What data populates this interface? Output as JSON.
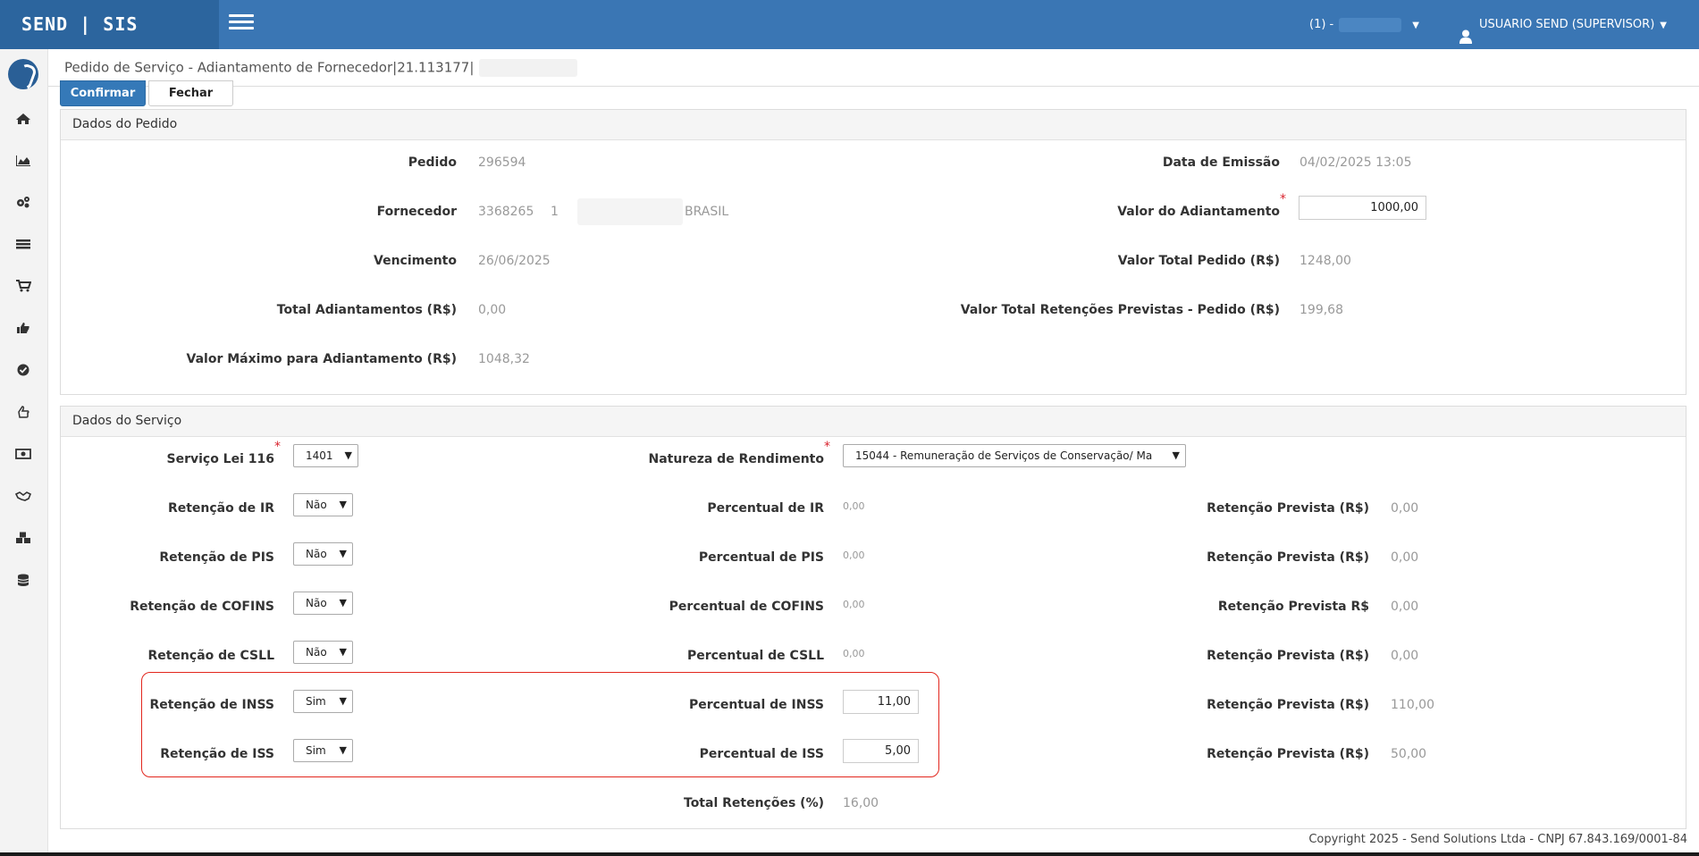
{
  "app": {
    "brand": "SEND | SIS",
    "env_label": "(1) -",
    "user": "USUARIO SEND (SUPERVISOR)"
  },
  "colors": {
    "header": "#3a76b4",
    "brand_bg": "#2c659e",
    "confirm": "#3579b8",
    "highlight": "#e2261d"
  },
  "page": {
    "breadcrumb": "Pedido de Serviço - Adiantamento de Fornecedor|21.113177|"
  },
  "toolbar": {
    "confirm": "Confirmar",
    "close": "Fechar"
  },
  "sidebar": {
    "icons": [
      "home-icon",
      "chart-icon",
      "cogs-icon",
      "list-icon",
      "cart-icon",
      "thumbs-up-icon",
      "check-circle-icon",
      "hand-icon",
      "money-icon",
      "handshake-icon",
      "cubes-icon",
      "database-icon"
    ]
  },
  "pedido": {
    "title": "Dados do Pedido",
    "pedido_label": "Pedido",
    "pedido_value": "296594",
    "fornecedor_label": "Fornecedor",
    "fornecedor_code": "3368265",
    "fornecedor_num": "1",
    "fornecedor_country": "BRASIL",
    "vencimento_label": "Vencimento",
    "vencimento_value": "26/06/2025",
    "total_adiant_label": "Total Adiantamentos (R$)",
    "total_adiant_value": "0,00",
    "valor_max_label": "Valor Máximo para Adiantamento (R$)",
    "valor_max_value": "1048,32",
    "data_emissao_label": "Data de Emissão",
    "data_emissao_value": "04/02/2025 13:05",
    "valor_adiant_label": "Valor do Adiantamento",
    "valor_adiant_value": "1000,00",
    "valor_total_label": "Valor Total Pedido (R$)",
    "valor_total_value": "1248,00",
    "valor_ret_label": "Valor Total Retenções Previstas - Pedido (R$)",
    "valor_ret_value": "199,68"
  },
  "servico": {
    "title": "Dados do Serviço",
    "lei116_label": "Serviço Lei 116",
    "lei116_value": "1401",
    "natureza_label": "Natureza de Rendimento",
    "natureza_value": "15044 - Remuneração de Serviços de Conservação/ Ma",
    "rows": [
      {
        "ret_label": "Retenção de IR",
        "ret_value": "Não",
        "perc_label": "Percentual de IR",
        "perc_value": "0,00",
        "prev_label": "Retenção Prevista (R$)",
        "prev_value": "0,00"
      },
      {
        "ret_label": "Retenção de PIS",
        "ret_value": "Não",
        "perc_label": "Percentual de PIS",
        "perc_value": "0,00",
        "prev_label": "Retenção Prevista (R$)",
        "prev_value": "0,00"
      },
      {
        "ret_label": "Retenção de COFINS",
        "ret_value": "Não",
        "perc_label": "Percentual de COFINS",
        "perc_value": "0,00",
        "prev_label": "Retenção Prevista R$",
        "prev_value": "0,00"
      },
      {
        "ret_label": "Retenção de CSLL",
        "ret_value": "Não",
        "perc_label": "Percentual de CSLL",
        "perc_value": "0,00",
        "prev_label": "Retenção Prevista (R$)",
        "prev_value": "0,00"
      },
      {
        "ret_label": "Retenção de INSS",
        "ret_value": "Sim",
        "perc_label": "Percentual de INSS",
        "perc_value": "11,00",
        "prev_label": "Retenção Prevista (R$)",
        "prev_value": "110,00"
      },
      {
        "ret_label": "Retenção de ISS",
        "ret_value": "Sim",
        "perc_label": "Percentual de ISS",
        "perc_value": "5,00",
        "prev_label": "Retenção Prevista (R$)",
        "prev_value": "50,00"
      }
    ],
    "total_label": "Total Retenções (%)",
    "total_value": "16,00"
  },
  "footer": {
    "copyright": "Copyright 2025 - Send Solutions Ltda - CNPJ 67.843.169/0001-84"
  }
}
